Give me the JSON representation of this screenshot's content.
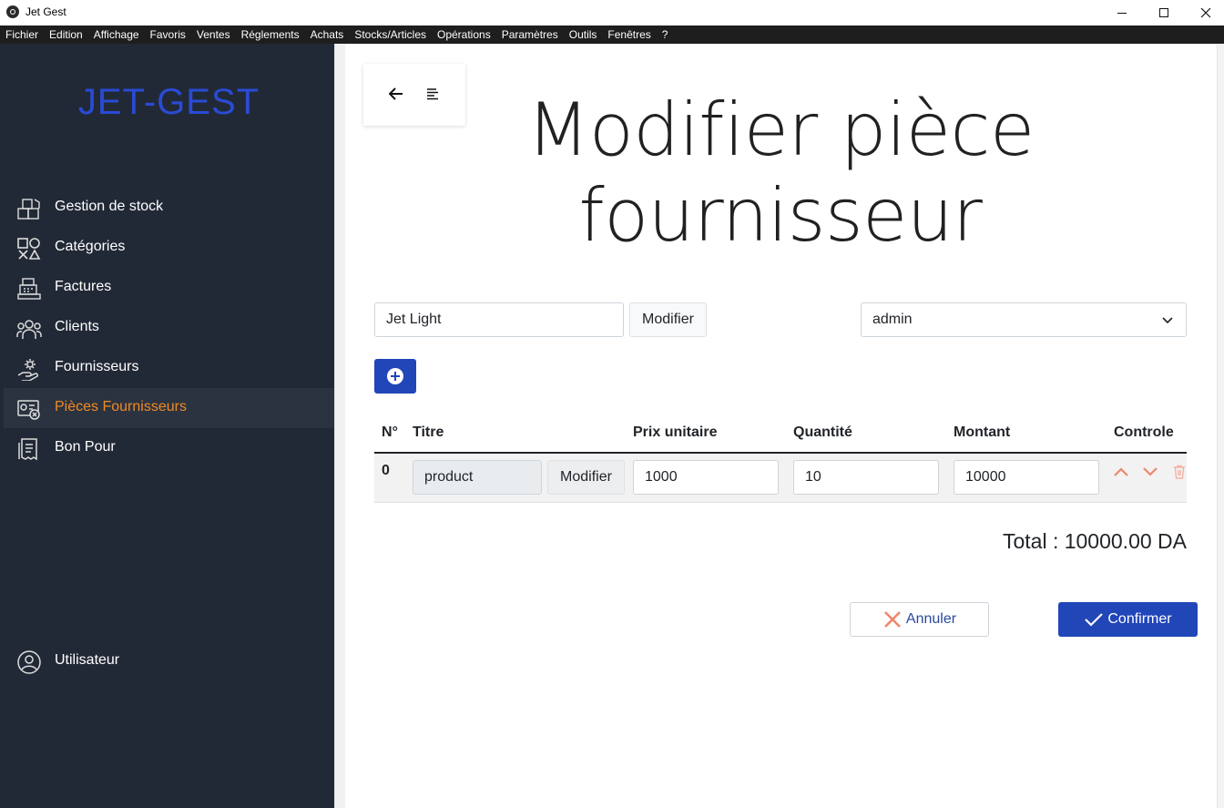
{
  "window": {
    "title": "Jet Gest"
  },
  "menu": [
    "Fichier",
    "Edition",
    "Affichage",
    "Favoris",
    "Ventes",
    "Réglements",
    "Achats",
    "Stocks/Articles",
    "Opérations",
    "Paramètres",
    "Outils",
    "Fenêtres",
    "?"
  ],
  "sidebar": {
    "brand": "JET-GEST",
    "items": [
      {
        "label": "Gestion de stock",
        "icon": "boxes-icon"
      },
      {
        "label": "Catégories",
        "icon": "shapes-icon"
      },
      {
        "label": "Factures",
        "icon": "cash-register-icon"
      },
      {
        "label": "Clients",
        "icon": "users-icon"
      },
      {
        "label": "Fournisseurs",
        "icon": "hand-gear-icon"
      },
      {
        "label": "Pièces Fournisseurs",
        "icon": "document-cancel-icon",
        "active": true
      },
      {
        "label": "Bon Pour",
        "icon": "receipt-icon"
      }
    ],
    "user": {
      "label": "Utilisateur",
      "icon": "user-circle-icon"
    }
  },
  "page": {
    "title_line1": "Modifier pièce",
    "title_line2": "fournisseur"
  },
  "form": {
    "supplier_value": "Jet Light",
    "modify_label": "Modifier",
    "user_select_value": "admin"
  },
  "table": {
    "headers": [
      "N°",
      "Titre",
      "Prix unitaire",
      "Quantité",
      "Montant",
      "Controle"
    ],
    "rows": [
      {
        "num": "0",
        "title": "product",
        "modify_label": "Modifier",
        "unit_price": "1000",
        "quantity": "10",
        "amount": "10000"
      }
    ]
  },
  "total": "Total : 10000.00 DA",
  "actions": {
    "cancel": "Annuler",
    "confirm": "Confirmer"
  },
  "colors": {
    "sidebar_bg": "#222936",
    "brand": "#2a4bd6",
    "active_item": "#f08a24",
    "primary": "#2146b8",
    "danger": "#f0866b"
  }
}
